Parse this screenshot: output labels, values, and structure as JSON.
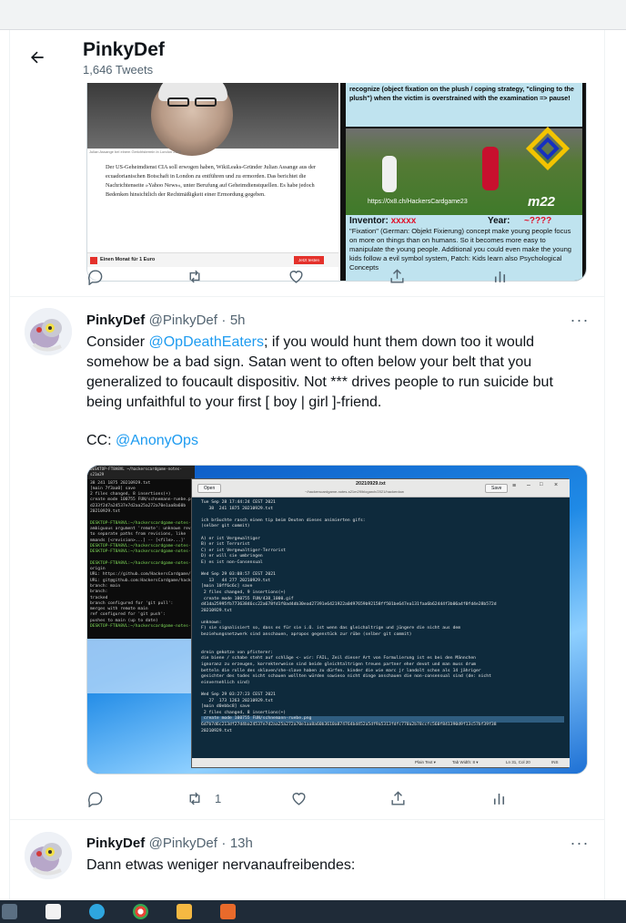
{
  "header": {
    "title": "PinkyDef",
    "tweet_count": "1,646 Tweets"
  },
  "previous_tweet": {
    "media_left": {
      "caption": "Julian Assange bei einem Gerichtstermin in London 2020",
      "article_text": "Der US-Geheimdienst CIA soll erwogen haben, WikiLeaks-Gründer Julian Assange aus der ecuadorianischen Botschaft in London zu entführen und zu ermorden. Das berichtet die Nachrichtenseite »Yahoo News«, unter Berufung auf Geheimdienstquellen. Es habe jedoch Bedenken hinsichtlich der Rechtmäßigkeit einer Ermordung gegeben.",
      "ad_text": "Einen Monat für 1 Euro",
      "ad_button": "Jetzt testen"
    },
    "media_right": {
      "top_text": "recognize (object fixation on the plush / coping strategy, \"clinging to the plush\") when the victim is overstrained with the examination => pause!",
      "url": "https://0x8.ch/HackersCardgame23",
      "tag": "m22",
      "inventor_label": "Inventor:",
      "inventor_value": "xxxxx",
      "year_label": "Year:",
      "year_value": "~????",
      "body_text": "\"Fixation\" (German: Objekt Fixierung) concept make young people focus on more on things than on humans. So it becomes more easy to manipulate the young people. Additional you could even make the young kids follow a evil symbol system, Patch: Kids learn also Psychological Concepts"
    },
    "actions": {
      "reply": "",
      "retweet": "",
      "like": "",
      "share": "",
      "analytics": ""
    }
  },
  "tweet1": {
    "name": "PinkyDef",
    "handle": "@PinkyDef",
    "dot": "·",
    "time": "5h",
    "text_before": "Consider ",
    "mention1": "@OpDeathEaters",
    "text_after": "; if you would hunt them down too it would somehow be a bad sign. Satan went to often below your belt that you generalized to foucault dispositiv. Not *** drives people to run suicide but being unfaithful to your first [ boy | girl ]-friend.",
    "cc_label": "CC: ",
    "mention2": "@AnonyOps",
    "media": {
      "terminal_title": "DESKTOP-FT8A8VL ~/hackerscardgame-notes-s21m29",
      "terminal_lines": [
        "38 241 1875 20210929.txt",
        "[main 7f3aa0] save",
        "2 files changed, 8 insertions(+)",
        "create mode 100755 FUN/schnemann-ruebe.png",
        "d233f2d7a24537e7d2aa25a272a70e1aa8a60b",
        "20210929.txt",
        "",
        "DESKTOP-FT8A8VL:~/hackerscardgame-notes-s21",
        "ambiguous argument 'remote': unknown revi",
        "to separate paths from revisions, like",
        "mmands [<revision>...] -- [<file>...]'",
        "DESKTOP-FT8A8VL:~/hackerscardgame-notes-s21",
        "DESKTOP-FT8A8VL:~/hackerscardgame-notes-s21",
        "",
        "DESKTOP-FT8A8VL:~/hackerscardgame-notes-s21",
        "origin",
        "URL: https://github.com/HackersCardgame/",
        "URL: git@github.com:HackersCardgame/hack",
        "branch: main",
        "branch:",
        "tracked",
        "branch configured for 'git pull':",
        "merges with remote main",
        "ref configured for 'git push':",
        "pushes to main (up to date)",
        "DESKTOP-FT8A8VL:~/hackerscardgame-notes-s21"
      ],
      "editor_open": "Open",
      "editor_filename": "20210929.txt",
      "editor_path": "~/hackerscardgame-notes-s21m29/blogarch/2021/hackerdow",
      "editor_save": "Save",
      "editor_lines": [
        "Tue Sep 28 17:44:24 CEST 2021",
        "   38  241 1875 20210929.txt",
        "",
        "ich bräuchte rasch einen tip beim Deuten dieses animierten gifs:",
        "(selber git commit)",
        "",
        "A) er ist Vergewaltiger",
        "B) er ist Terrorist",
        "C) er ist Vergewaltiger-Terrorist",
        "D) er will sie umbringen",
        "E) es ist non-Consensual",
        "",
        "Wed Sep 29 03:08:57 CEST 2021",
        "   13   44 277 20210929.txt",
        "[main 10ff6c6c] save",
        " 2 files changed, 9 insertions(+)",
        " create mode 100755 FUN/438_1000.gif",
        "d41da25995fb77363846cc22a678fd1f0ad4db30ead27391e6421922a0497659b92158ff501be647ea131faa6b62444f3b06a4f0fd4e28b572d",
        "20210929.txt",
        "",
        "unknown:",
        "F) sie signalisiert so, dass es für sie i.O. ist wenn das gleichaltrige und jüngere die nicht aus dem",
        "beziehungsnetzwerk sind anschauen, apropos gegenstück zur rübe (selber git commit)",
        "",
        "",
        "drein gekotze von pfisterer:",
        "die biene / schabe steht auf schläge <- wir: FAIL, Zeil dieser Art von Formulierung ist es bei den Männchen",
        "ignoranz zu erzeugen, korrekterweise sind beide gleichtaltrigen treuen partner eher devot und man muss drum",
        "betteln die rolle des sklaven/she-slave haben zu dürfen. kinder die wie marc jr landolt schon als 14 jähriger",
        "gesichter des todes nicht schauen wollten würden sowieso nicht dinge anschauen die non-consensual sind (de: nicht",
        "einvernehlich sind)",
        "",
        "Wed Sep 29 03:27:23 CEST 2021",
        "   27  173 1263 20210929.txt",
        "[main d0ebbc8] save",
        " 2 files changed, 8 insertions(+)",
        " create mode 100755 FUN/schnemann-ruebe.png",
        "6d7b7d6c213df27d4ba24537e7d2aa25a272a70e1aa8a60b3610a874764bd452a5df9a5313fdfc770a2b78ccfc560f841390d9f13c57bf39f38",
        "20210929.txt"
      ],
      "status_plain": "Plain Text ▾",
      "status_tab": "Tab Width: 8 ▾",
      "status_pos": "Ln 31, Col 20",
      "status_ins": "INS"
    },
    "actions": {
      "reply": "",
      "retweet": "1",
      "like": "",
      "share": "",
      "analytics": ""
    }
  },
  "tweet2": {
    "name": "PinkyDef",
    "handle": "@PinkyDef",
    "dot": "·",
    "time": "13h",
    "text": "Dann etwas weniger nervanaufreibendes:"
  },
  "colors": {
    "accent": "#1d9bf0",
    "text_secondary": "#536471",
    "border": "#eff3f4",
    "editor_bg": "#0e2a3c",
    "desktop_blue": "#1b6fd1"
  }
}
